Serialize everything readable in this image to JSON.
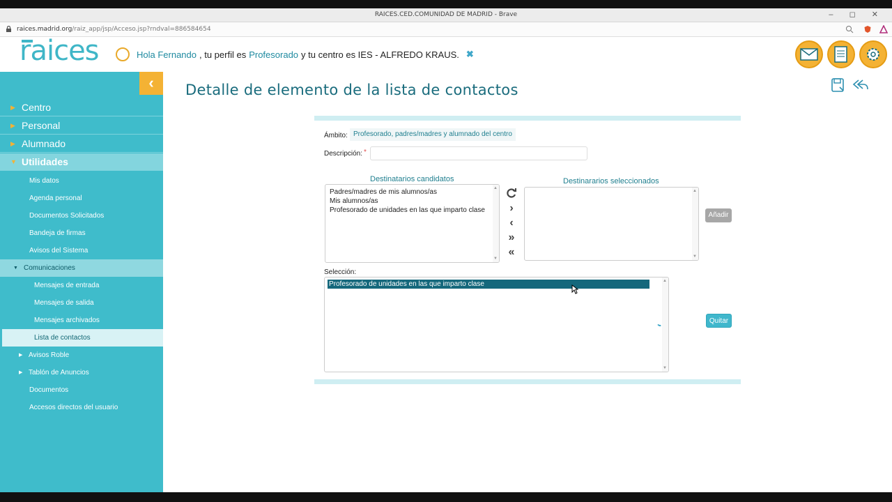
{
  "window": {
    "title": "RAICES.CED.COMUNIDAD DE MADRID - Brave"
  },
  "address": {
    "host": "raices.madrid.org",
    "path": "/raiz_app/jsp/Acceso.jsp?rndval=886584654"
  },
  "header": {
    "logo": "raices",
    "greeting_1": "Hola Fernando",
    "greeting_2": ", tu perfil es",
    "profile": "Profesorado",
    "greeting_3": "y tu centro es IES - ALFREDO KRAUS.",
    "close_symbol": "✖"
  },
  "sidebar": {
    "collapse_symbol": "‹",
    "top": [
      "Centro",
      "Personal",
      "Alumnado",
      "Utilidades"
    ],
    "utilidades": [
      "Mis datos",
      "Agenda personal",
      "Documentos Solicitados",
      "Bandeja de firmas",
      "Avisos del Sistema"
    ],
    "comunicaciones": "Comunicaciones",
    "comunicaciones_items": [
      "Mensajes de entrada",
      "Mensajes de salida",
      "Mensajes archivados",
      "Lista de contactos"
    ],
    "rest": [
      "Avisos Roble",
      "Tablón de Anuncios",
      "Documentos",
      "Accesos directos del usuario"
    ]
  },
  "main": {
    "title": "Detalle de elemento de la lista de contactos",
    "ambito_label": "Ámbito:",
    "ambito_value": "Profesorado, padres/madres y alumnado del centro",
    "descripcion_label": "Descripción:",
    "descripcion_value": "",
    "required_mark": "*",
    "candidatos_title": "Destinatarios candidatos",
    "candidatos": [
      "Padres/madres de mis alumnos/as",
      "Mis alumnos/as",
      "Profesorado de unidades en las que imparto clase"
    ],
    "seleccionados_title": "Destinararios seleccionados",
    "anadir_label": "Añadir",
    "seleccion_label": "Selección:",
    "seleccion_items": [
      "Profesorado de unidades en las que imparto clase"
    ],
    "quitar_label": "Quitar"
  },
  "colors": {
    "teal": "#3fbccb",
    "accent": "#f4b234",
    "title": "#1a6c7d"
  }
}
